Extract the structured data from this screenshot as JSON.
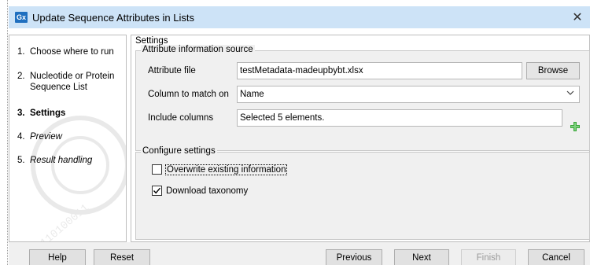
{
  "window": {
    "app_icon_text": "Gx",
    "title": "Update Sequence Attributes in Lists",
    "close_glyph": "✕",
    "close_icon": "close-icon"
  },
  "steps": [
    {
      "number": "1.",
      "label": "Choose where to run",
      "state": "done"
    },
    {
      "number": "2.",
      "label_line1": "Nucleotide or Protein",
      "label_line2": "Sequence List",
      "state": "done"
    },
    {
      "number": "3.",
      "label": "Settings",
      "state": "current"
    },
    {
      "number": "4.",
      "label": "Preview",
      "state": "upcoming"
    },
    {
      "number": "5.",
      "label": "Result handling",
      "state": "upcoming"
    }
  ],
  "settings": {
    "caption": "Settings",
    "attribute_source": {
      "title": "Attribute information source",
      "attribute_file_label": "Attribute file",
      "attribute_file_value": "testMetadata-madeupbybt.xlsx",
      "browse_label": "Browse",
      "column_match_label": "Column to match on",
      "column_match_value": "Name",
      "include_columns_label": "Include columns",
      "include_columns_value": "Selected 5 elements.",
      "add_icon": "plus-icon"
    },
    "configure": {
      "title": "Configure settings",
      "overwrite_label": "Overwrite existing information",
      "overwrite_checked": false,
      "download_taxonomy_label": "Download taxonomy",
      "download_taxonomy_checked": true
    }
  },
  "footer": {
    "help": "Help",
    "reset": "Reset",
    "previous": "Previous",
    "next": "Next",
    "finish": "Finish",
    "cancel": "Cancel"
  },
  "colors": {
    "titlebar": "#cde3f7",
    "panel_bg": "#f0f0f0",
    "plus_green": "#3aa63a"
  }
}
